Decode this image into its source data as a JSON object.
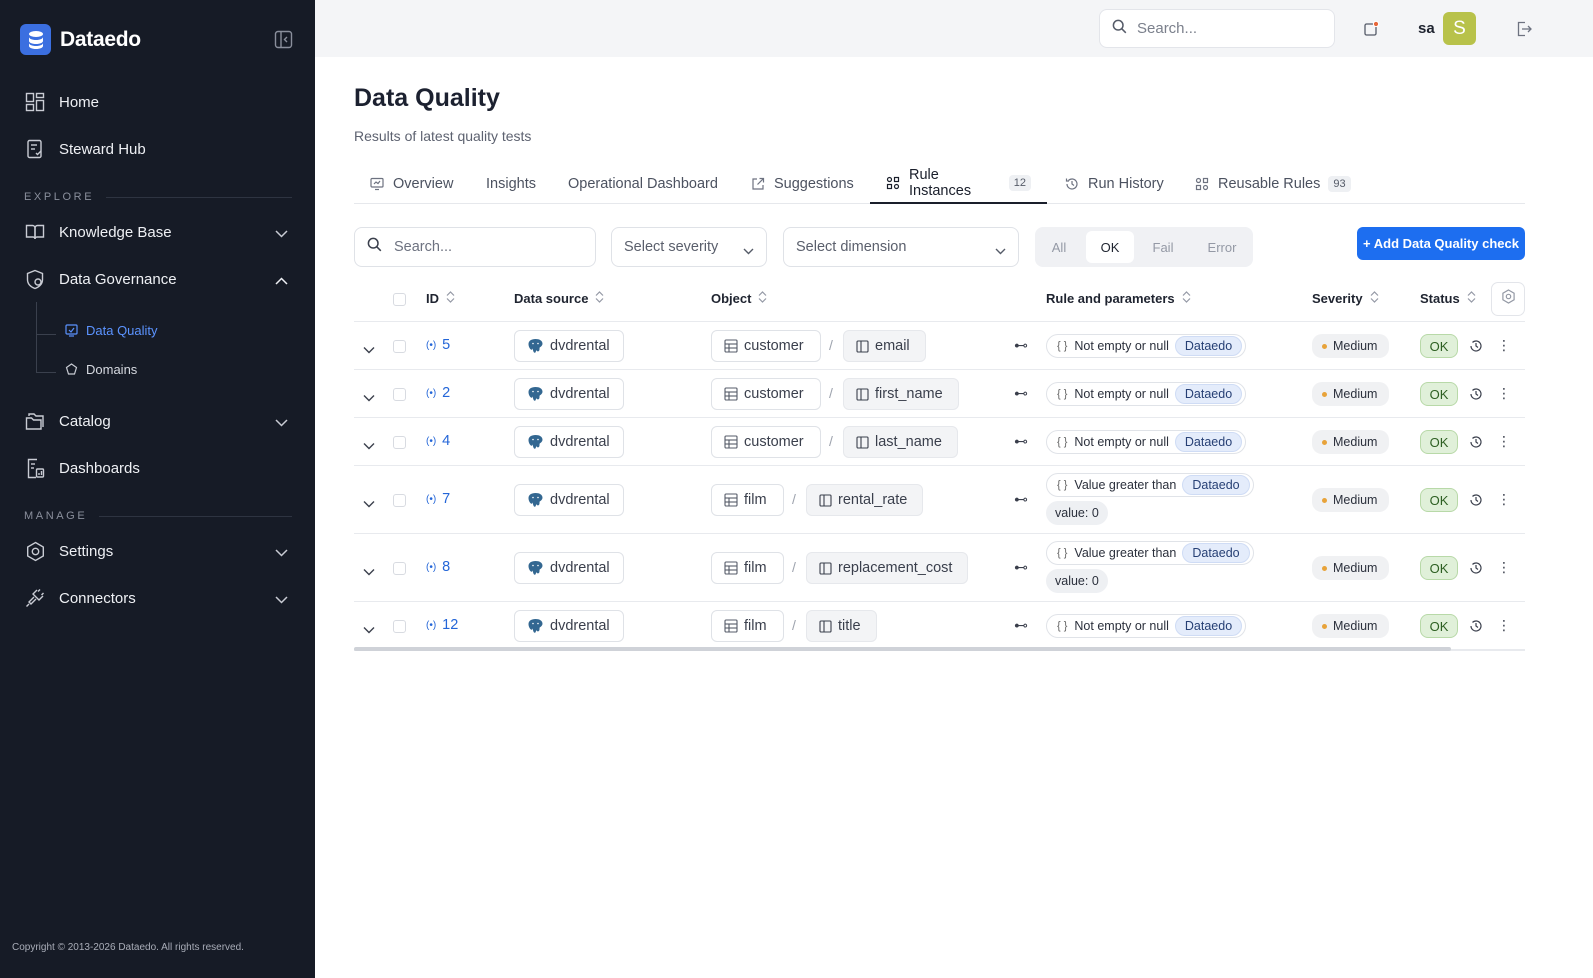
{
  "app": {
    "brand": "Dataedo",
    "copyright": "Copyright © 2013-2026 Dataedo. All rights reserved."
  },
  "sidebar": {
    "home": "Home",
    "steward_hub": "Steward Hub",
    "explore_label": "EXPLORE",
    "knowledge_base": "Knowledge Base",
    "data_governance": "Data Governance",
    "data_quality": "Data Quality",
    "domains": "Domains",
    "catalog": "Catalog",
    "dashboards": "Dashboards",
    "manage_label": "MANAGE",
    "settings": "Settings",
    "connectors": "Connectors"
  },
  "topbar": {
    "search_placeholder": "Search...",
    "user": "sa",
    "avatar_letter": "S",
    "avatar_color": "#b8c24a"
  },
  "page": {
    "title": "Data Quality",
    "subtitle": "Results of latest quality tests"
  },
  "tabs": [
    {
      "label": "Overview"
    },
    {
      "label": "Insights"
    },
    {
      "label": "Operational Dashboard"
    },
    {
      "label": "Suggestions"
    },
    {
      "label": "Rule Instances",
      "count": "12"
    },
    {
      "label": "Run History"
    },
    {
      "label": "Reusable Rules",
      "count": "93"
    }
  ],
  "filters": {
    "search_placeholder": "Search...",
    "severity": "Select severity",
    "dimension": "Select dimension",
    "status_options": [
      "All",
      "OK",
      "Fail",
      "Error"
    ],
    "status_selected": "OK",
    "add_button": "+ Add Data Quality check",
    "accent": "#1d6ef0"
  },
  "table": {
    "columns": [
      "ID",
      "Data source",
      "Object",
      "Rule and parameters",
      "Severity",
      "Status"
    ],
    "rows": [
      {
        "id": "5",
        "source": "dvdrental",
        "table": "customer",
        "column": "email",
        "rule": "Not empty or null",
        "rule_tag": "Dataedo",
        "param": "",
        "severity": "Medium",
        "status": "OK"
      },
      {
        "id": "2",
        "source": "dvdrental",
        "table": "customer",
        "column": "first_name",
        "rule": "Not empty or null",
        "rule_tag": "Dataedo",
        "param": "",
        "severity": "Medium",
        "status": "OK"
      },
      {
        "id": "4",
        "source": "dvdrental",
        "table": "customer",
        "column": "last_name",
        "rule": "Not empty or null",
        "rule_tag": "Dataedo",
        "param": "",
        "severity": "Medium",
        "status": "OK"
      },
      {
        "id": "7",
        "source": "dvdrental",
        "table": "film",
        "column": "rental_rate",
        "rule": "Value greater than",
        "rule_tag": "Dataedo",
        "param": "value: 0",
        "severity": "Medium",
        "status": "OK"
      },
      {
        "id": "8",
        "source": "dvdrental",
        "table": "film",
        "column": "replacement_cost",
        "rule": "Value greater than",
        "rule_tag": "Dataedo",
        "param": "value: 0",
        "severity": "Medium",
        "status": "OK"
      },
      {
        "id": "12",
        "source": "dvdrental",
        "table": "film",
        "column": "title",
        "rule": "Not empty or null",
        "rule_tag": "Dataedo",
        "param": "",
        "severity": "Medium",
        "status": "OK"
      }
    ]
  }
}
